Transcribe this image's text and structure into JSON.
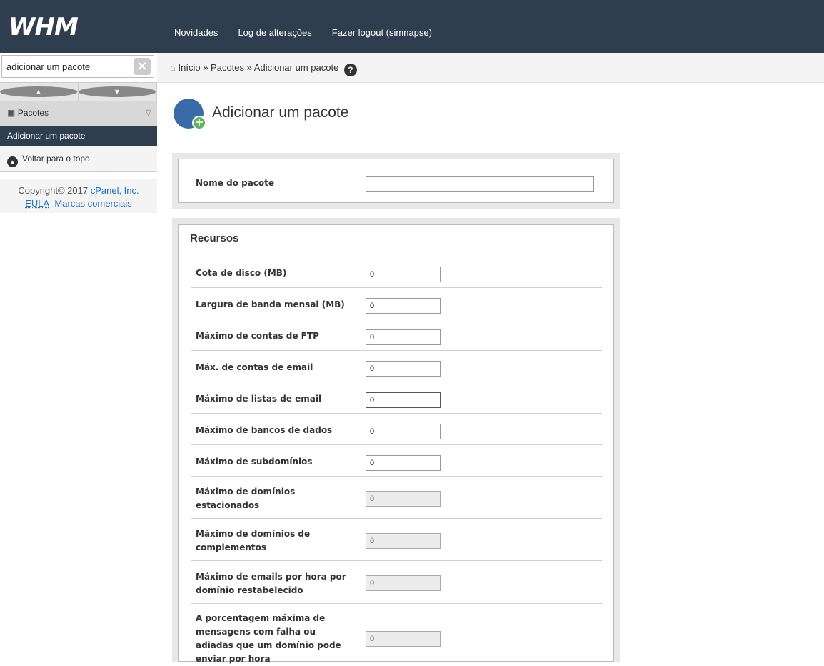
{
  "header": {
    "logo": "WHM",
    "nav": [
      "Novidades",
      "Log de alterações",
      "Fazer logout (simnapse)"
    ]
  },
  "sidebar": {
    "search_value": "adicionar um pacote",
    "category": "Pacotes",
    "active_item": "Adicionar um pacote",
    "back_to_top": "Voltar para o topo",
    "copyright": "Copyright© 2017 ",
    "copyright_link": "cPanel, Inc.",
    "eula": "EULA",
    "trademarks": "Marcas comerciais"
  },
  "breadcrumb": {
    "home": "Início",
    "sep1": "»",
    "packages": "Pacotes",
    "sep2": "»",
    "current": "Adicionar um pacote"
  },
  "page": {
    "title": "Adicionar um pacote",
    "package_name_label": "Nome do pacote",
    "package_name_value": ""
  },
  "resources": {
    "title": "Recursos",
    "rows": [
      {
        "label": "Cota de disco (MB)",
        "value": "0"
      },
      {
        "label": "Largura de banda mensal (MB)",
        "value": "0"
      },
      {
        "label": "Máximo de contas de FTP",
        "value": "0"
      },
      {
        "label": "Máx. de contas de email",
        "value": "0"
      },
      {
        "label": "Máximo de listas de email",
        "value": "0"
      },
      {
        "label": "Máximo de bancos de dados",
        "value": "0"
      },
      {
        "label": "Máximo de subdomínios",
        "value": "0"
      },
      {
        "label": "Máximo de domínios estacionados",
        "value": "0"
      },
      {
        "label": "Máximo de domínios de complementos",
        "value": "0"
      },
      {
        "label": "Máximo de emails por hora por domínio restabelecido",
        "value": "0"
      },
      {
        "label": "A porcentagem máxima de mensagens com falha ou adiadas que um domínio pode enviar por hora",
        "value": "0"
      }
    ]
  }
}
